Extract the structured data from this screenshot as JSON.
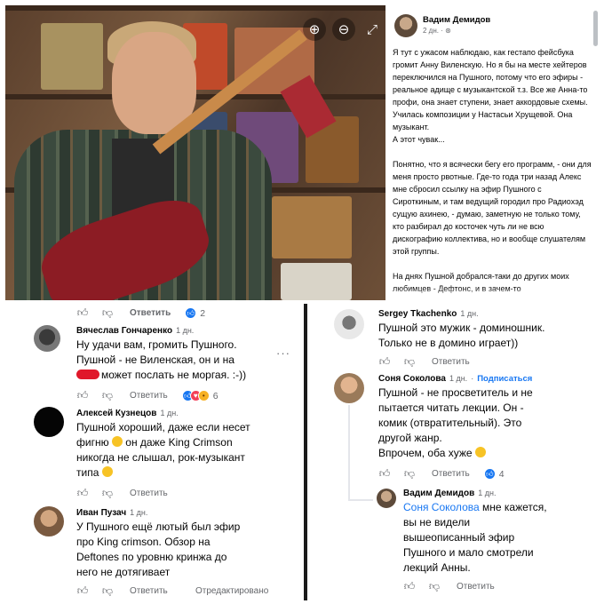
{
  "photo": {
    "controls": {
      "zoom_in": "⊕",
      "zoom_out": "⊖",
      "expand": "⤢"
    }
  },
  "post": {
    "author": "Вадим Демидов",
    "meta": "2 дн. · ⊛",
    "paragraphs": [
      [
        "Я тут с ужасом наблюдаю, как гестапо фейсбука громит Анну Виленскую. Но я бы на месте хейтеров переключился на Пушного, потому что его эфиры - реальное адище с музыкантской т.з. Все же Анна-то профи, она знает ступени, знает аккордовые схемы. Училась композиции у Настасьи Хрущевой. Она музыкант.",
        "А этот чувак..."
      ],
      [
        "Понятно, что я всячески бегу его программ, - они для меня просто рвотные. Где-то года три назад Алекс мне сбросил ссылку на эфир Пушного с Сироткиным, и там ведущий городил про Радиохэд сущую ахинею, - думаю, заметную не только тому, кто разбирал до косточек чуть ли не всю дискографию коллектива, но и вообще слушателям этой группы."
      ],
      [
        "На днях Пушной добрался-таки до других моих любимцев - Дефтонс, и в зачем-то"
      ]
    ]
  },
  "left_panel": {
    "top_actions": {
      "reply": "Ответить",
      "reactions_count": "2"
    },
    "comments": [
      {
        "name": "Вячеслав Гончаренко",
        "time": "1 дн.",
        "lines": [
          "Ну удачи вам, громить Пушного.",
          "Пушной - не Виленская, он и на",
          "может послать не моргая. :-))"
        ],
        "reply": "Ответить",
        "reactions_count": "6"
      },
      {
        "name": "Алексей Кузнецов",
        "time": "1 дн.",
        "lines": [
          "Пушной хороший, даже если несет",
          "фигню",
          "он даже King Crimson",
          "никогда не слышал, рок-музыкант",
          "типа"
        ],
        "reply": "Ответить"
      },
      {
        "name": "Иван Пузач",
        "time": "1 дн.",
        "lines": [
          "У Пушного ещё лютый был эфир",
          "про King crimson. Обзор на",
          "Deftones по уровню кринжа до",
          "него не дотягивает"
        ],
        "reply": "Ответить",
        "edited": "Отредактировано"
      }
    ]
  },
  "right_panel": {
    "comments": [
      {
        "name": "Sergey Tkachenko",
        "time": "1 дн.",
        "lines": [
          "Пушной это мужик - доминошник.",
          "Только не в домино играет))"
        ],
        "reply": "Ответить"
      },
      {
        "name": "Соня Соколова",
        "time": "1 дн.",
        "subscribe": "Подписаться",
        "lines": [
          "Пушной - не просветитель и не",
          "пытается читать лекции. Он -",
          "комик (отвратительный). Это",
          "другой жанр.",
          "Впрочем, оба хуже"
        ],
        "reply": "Ответить",
        "reactions_count": "4"
      },
      {
        "name": "Вадим Демидов",
        "time": "1 дн.",
        "mention": "Соня Соколова",
        "lines": [
          "мне кажется,",
          "вы не видели",
          "вышеописанный эфир",
          "Пушного и мало смотрели",
          "лекций Анны."
        ],
        "reply": "Ответить"
      }
    ]
  },
  "colors": {
    "accent": "#1877f2",
    "meta": "#65676b",
    "text": "#050505"
  }
}
